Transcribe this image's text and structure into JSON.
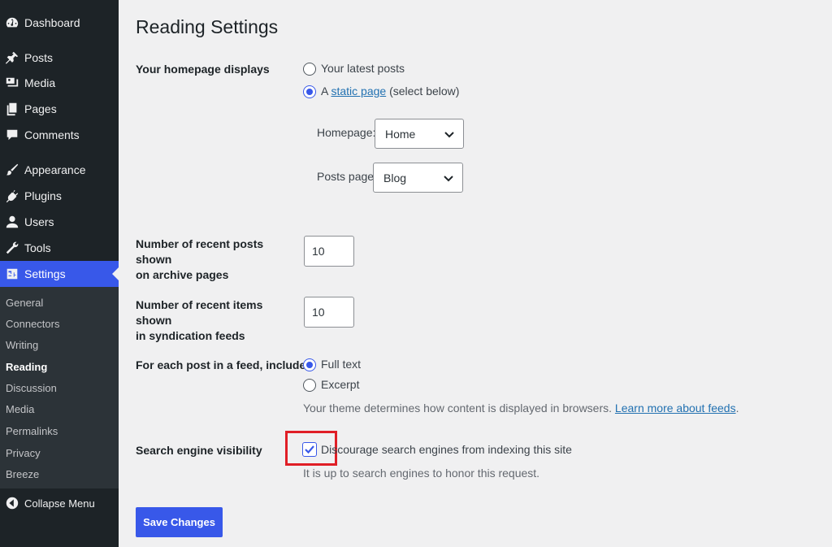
{
  "sidebar": {
    "items": [
      {
        "label": "Dashboard",
        "icon": "dashboard-icon"
      },
      {
        "label": "Posts",
        "icon": "pin-icon"
      },
      {
        "label": "Media",
        "icon": "media-icon"
      },
      {
        "label": "Pages",
        "icon": "pages-icon"
      },
      {
        "label": "Comments",
        "icon": "comment-icon"
      },
      {
        "label": "Appearance",
        "icon": "brush-icon"
      },
      {
        "label": "Plugins",
        "icon": "plug-icon"
      },
      {
        "label": "Users",
        "icon": "user-icon"
      },
      {
        "label": "Tools",
        "icon": "wrench-icon"
      },
      {
        "label": "Settings",
        "icon": "settings-icon"
      }
    ],
    "submenu": [
      "General",
      "Connectors",
      "Writing",
      "Reading",
      "Discussion",
      "Media",
      "Permalinks",
      "Privacy",
      "Breeze"
    ],
    "collapse_label": "Collapse Menu",
    "accent": "#3858e9"
  },
  "page": {
    "title": "Reading Settings",
    "homepage_displays": {
      "label": "Your homepage displays",
      "option_latest": "Your latest posts",
      "option_static_prefix": "A",
      "option_static_link": "static page",
      "option_static_suffix": "(select below)",
      "selected": "static page",
      "homepage_label": "Homepage:",
      "homepage_value": "Home",
      "posts_page_label": "Posts page:",
      "posts_page_value": "Blog"
    },
    "posts_per_page": {
      "label_line1": "Number of recent posts shown",
      "label_line2": "on archive pages",
      "value": "10"
    },
    "posts_per_rss": {
      "label_line1": "Number of recent items shown",
      "label_line2": "in syndication feeds",
      "value": "10"
    },
    "feed_content": {
      "label": "For each post in a feed, include",
      "option_full": "Full text",
      "option_excerpt": "Excerpt",
      "selected": "Full text",
      "desc_prefix": "Your theme determines how content is displayed in browsers.",
      "desc_link": "Learn more about feeds",
      "desc_suffix": "."
    },
    "search_visibility": {
      "label": "Search engine visibility",
      "checkbox_label": "Discourage search engines from indexing this site",
      "checked": true,
      "desc": "It is up to search engines to honor this request."
    },
    "save_label": "Save Changes"
  }
}
